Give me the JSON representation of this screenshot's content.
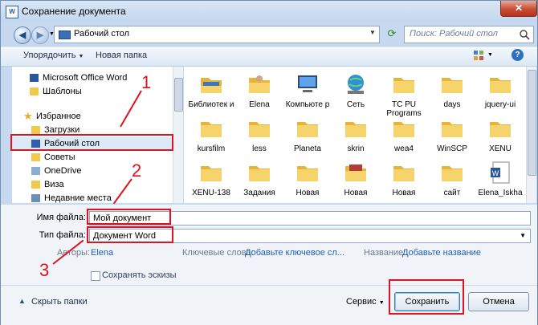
{
  "window": {
    "title": "Сохранение документа",
    "title_icon": "W"
  },
  "address": {
    "path": "Рабочий стол",
    "search_placeholder": "Поиск: Рабочий стол"
  },
  "toolbar": {
    "organize": "Упорядочить",
    "new_folder": "Новая папка"
  },
  "sidebar": {
    "items": [
      {
        "label": "Microsoft Office Word",
        "icon": "word-icon"
      },
      {
        "label": "Шаблоны",
        "icon": "folder-icon"
      },
      {
        "label": "Избранное",
        "icon": "star-icon"
      },
      {
        "label": "Загрузки",
        "icon": "folder-icon"
      },
      {
        "label": "Рабочий стол",
        "icon": "desktop-icon"
      },
      {
        "label": "Советы",
        "icon": "folder-icon"
      },
      {
        "label": "OneDrive",
        "icon": "folder-icon"
      },
      {
        "label": "Виза",
        "icon": "folder-icon"
      },
      {
        "label": "Недавние места",
        "icon": "recent-icon"
      }
    ]
  },
  "files": [
    {
      "name": "Библиотек и",
      "icon": "library-icon"
    },
    {
      "name": "Elena",
      "icon": "user-folder-icon"
    },
    {
      "name": "Компьюте р",
      "icon": "computer-icon"
    },
    {
      "name": "Сеть",
      "icon": "network-icon"
    },
    {
      "name": "TC PU Programs",
      "icon": "folder-icon"
    },
    {
      "name": "days",
      "icon": "folder-icon"
    },
    {
      "name": "jquery-ui",
      "icon": "folder-icon"
    },
    {
      "name": "kursfilm",
      "icon": "folder-icon"
    },
    {
      "name": "less",
      "icon": "folder-icon"
    },
    {
      "name": "Planeta",
      "icon": "folder-icon"
    },
    {
      "name": "skrin",
      "icon": "folder-icon"
    },
    {
      "name": "wea4",
      "icon": "folder-icon"
    },
    {
      "name": "WinSCP",
      "icon": "folder-icon"
    },
    {
      "name": "XENU",
      "icon": "folder-icon"
    },
    {
      "name": "XENU-138",
      "icon": "folder-icon"
    },
    {
      "name": "Задания",
      "icon": "folder-icon"
    },
    {
      "name": "Новая",
      "icon": "folder-icon"
    },
    {
      "name": "Новая",
      "icon": "picture-folder-icon"
    },
    {
      "name": "Новая",
      "icon": "folder-icon"
    },
    {
      "name": "сайт",
      "icon": "folder-icon"
    },
    {
      "name": "Elena_Iskha",
      "icon": "word-doc-icon"
    }
  ],
  "form": {
    "filename_label": "Имя файла:",
    "filename_value": "Мой документ",
    "filetype_label": "Тип файла:",
    "filetype_value": "Документ Word",
    "authors_label": "Авторы:",
    "authors_value": "Elena",
    "keywords_label": "Ключевые слова:",
    "keywords_value": "Добавьте ключевое сл...",
    "name_label": "Название:",
    "name_value": "Добавьте название",
    "thumbs_label": "Сохранять эскизы"
  },
  "bottom": {
    "hide_folders": "Скрыть папки",
    "service": "Сервис",
    "save": "Сохранить",
    "cancel": "Отмена"
  },
  "annotations": [
    "1",
    "2",
    "3"
  ],
  "colors": {
    "annotation_red": "#e0121d",
    "folder": "#f2c94c",
    "selection": "#dce9f8"
  }
}
